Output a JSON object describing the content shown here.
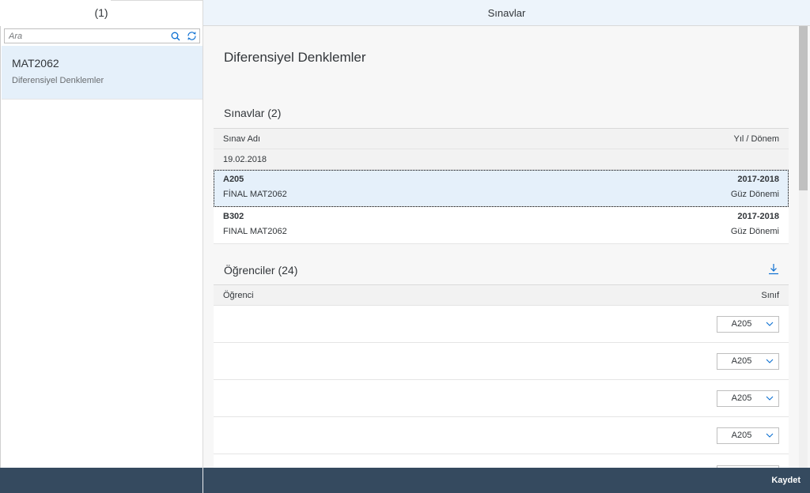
{
  "master": {
    "header_count": "(1)",
    "search_placeholder": "Ara",
    "items": [
      {
        "code": "MAT2062",
        "name": "Diferensiyel Denklemler"
      }
    ]
  },
  "detail": {
    "header_title": "Sınavlar",
    "page_title": "Diferensiyel Denklemler",
    "exams_section": {
      "title": "Sınavlar (2)",
      "columns": [
        "Sınav Adı",
        "Yıl / Dönem"
      ],
      "group_label": "19.02.2018",
      "rows": [
        {
          "room": "A205",
          "name": "FİNAL MAT2062",
          "year": "2017-2018",
          "term": "Güz Dönemi",
          "selected": true
        },
        {
          "room": "B302",
          "name": "FINAL MAT2062",
          "year": "2017-2018",
          "term": "Güz Dönemi",
          "selected": false
        }
      ]
    },
    "students_section": {
      "title": "Öğrenciler (24)",
      "columns": [
        "Öğrenci",
        "Sınıf"
      ],
      "rows": [
        {
          "class": "A205"
        },
        {
          "class": "A205"
        },
        {
          "class": "A205"
        },
        {
          "class": "A205"
        }
      ]
    }
  },
  "footer": {
    "save_label": "Kaydet"
  },
  "icons": {
    "search": "search-icon",
    "refresh": "refresh-icon",
    "download": "download-icon",
    "chevron": "chevron-down-icon"
  },
  "colors": {
    "accent": "#0a6ed1",
    "selected_bg": "#e5f0fa",
    "footer_bg": "#354a5f"
  }
}
